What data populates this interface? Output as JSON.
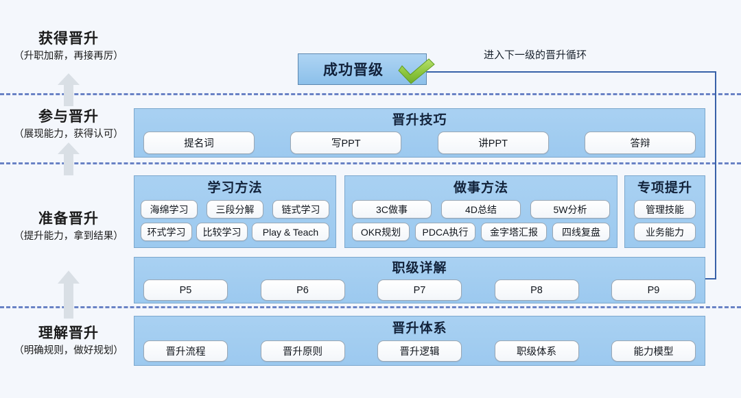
{
  "theme": {
    "background": "#f4f7fc",
    "panel_fill": "#a2cdf0",
    "panel_border": "#7ba7cd",
    "chip_fill": "#ffffff",
    "chip_border": "#9aa7b4",
    "divider_color": "#5a76c0",
    "arrow_color": "#d6dde4",
    "connector_color": "#3761a8",
    "check_color": "#7ac143"
  },
  "stages": [
    {
      "id": "obtain",
      "title": "获得晋升",
      "subtitle": "（升职加薪，再接再厉）"
    },
    {
      "id": "participate",
      "title": "参与晋升",
      "subtitle": "（展现能力，获得认可）"
    },
    {
      "id": "prepare",
      "title": "准备晋升",
      "subtitle": "（提升能力，拿到结果）"
    },
    {
      "id": "understand",
      "title": "理解晋升",
      "subtitle": "（明确规则，做好规划）"
    }
  ],
  "success": {
    "label": "成功晋级",
    "icon": "green-check-icon"
  },
  "loop": {
    "label": "进入下一级的晋升循环"
  },
  "panels": {
    "skills": {
      "title": "晋升技巧",
      "items": [
        "提名词",
        "写PPT",
        "讲PPT",
        "答辩"
      ]
    },
    "learning": {
      "title": "学习方法",
      "row1": [
        "海绵学习",
        "三段分解",
        "链式学习"
      ],
      "row2": [
        "环式学习",
        "比较学习",
        "Play & Teach"
      ]
    },
    "doing": {
      "title": "做事方法",
      "row1": [
        "3C做事",
        "4D总结",
        "5W分析"
      ],
      "row2": [
        "OKR规划",
        "PDCA执行",
        "金字塔汇报",
        "四线复盘"
      ]
    },
    "special": {
      "title": "专项提升",
      "items": [
        "管理技能",
        "业务能力"
      ]
    },
    "levels": {
      "title": "职级详解",
      "items": [
        "P5",
        "P6",
        "P7",
        "P8",
        "P9"
      ]
    },
    "system": {
      "title": "晋升体系",
      "items": [
        "晋升流程",
        "晋升原则",
        "晋升逻辑",
        "职级体系",
        "能力模型"
      ]
    }
  }
}
